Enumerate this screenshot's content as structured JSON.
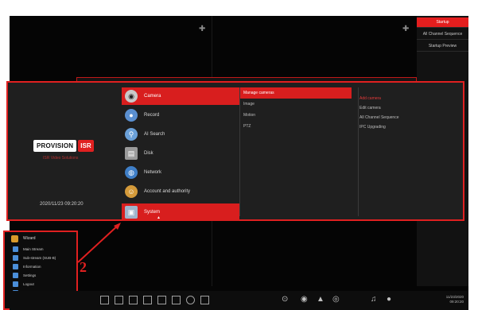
{
  "right_panel": {
    "items": [
      {
        "label": "Startup",
        "active": true
      },
      {
        "label": "All Channel Sequence",
        "active": false
      },
      {
        "label": "Startup Preview",
        "active": false
      }
    ]
  },
  "main_menu": {
    "logo_text": "PROVISION",
    "logo_badge": "ISR",
    "logo_subtitle": "ISR Video Solutions",
    "datetime": "2020/11/23 09:20:20",
    "categories": [
      {
        "label": "Camera",
        "icon": "camera-icon",
        "active": true
      },
      {
        "label": "Record",
        "icon": "record-icon",
        "active": false
      },
      {
        "label": "AI Search",
        "icon": "ai-search-icon",
        "active": false
      },
      {
        "label": "Disk",
        "icon": "disk-icon",
        "active": false
      },
      {
        "label": "Network",
        "icon": "network-icon",
        "active": false
      },
      {
        "label": "Account and authority",
        "icon": "account-icon",
        "active": false
      },
      {
        "label": "System",
        "icon": "system-icon",
        "active": true
      }
    ],
    "submenu": [
      {
        "label": "Manage cameras",
        "active": true
      },
      {
        "label": "Image",
        "active": false
      },
      {
        "label": "Motion",
        "active": false
      },
      {
        "label": "PTZ",
        "active": false
      }
    ],
    "submenu2": [
      {
        "label": "Add camera",
        "highlight": true
      },
      {
        "label": "Edit camera",
        "highlight": false
      },
      {
        "label": "All Channel Sequence",
        "highlight": false
      },
      {
        "label": "IPC Upgrading",
        "highlight": false
      }
    ]
  },
  "start_list": {
    "header": "Wizard",
    "items": [
      "Main Stream",
      "Sub-stream (SUB-B)",
      "Information",
      "Settings",
      "Logout",
      "Shutdown"
    ]
  },
  "annotation": {
    "number": "2",
    "color": "#e02020"
  },
  "toolbar": {
    "date": "11/23/2020",
    "time": "09:20:20"
  },
  "colors": {
    "accent": "#e02020",
    "background": "#050505"
  }
}
